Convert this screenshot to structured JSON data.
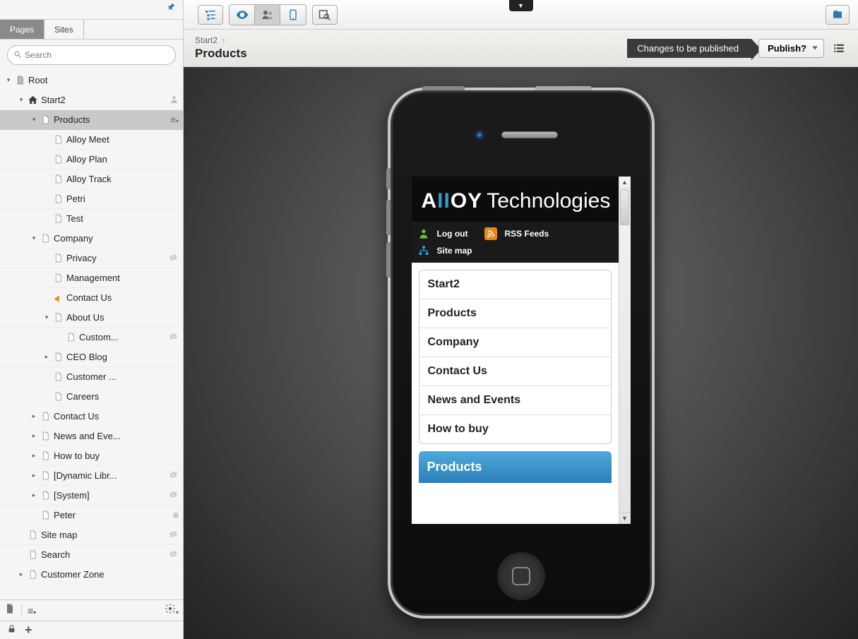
{
  "sidebar": {
    "tabs": {
      "pages": "Pages",
      "sites": "Sites"
    },
    "search_placeholder": "Search",
    "tree": [
      {
        "label": "Root",
        "depth": 0,
        "toggle": "minus",
        "icon": "page-grey"
      },
      {
        "label": "Start2",
        "depth": 1,
        "toggle": "minus",
        "icon": "home",
        "right_icon": "person"
      },
      {
        "label": "Products",
        "depth": 2,
        "toggle": "minus",
        "icon": "page",
        "selected": true,
        "right_icon": "menu"
      },
      {
        "label": "Alloy Meet",
        "depth": 3,
        "icon": "page"
      },
      {
        "label": "Alloy Plan",
        "depth": 3,
        "icon": "page"
      },
      {
        "label": "Alloy Track",
        "depth": 3,
        "icon": "page"
      },
      {
        "label": "Petri",
        "depth": 3,
        "icon": "page"
      },
      {
        "label": "Test",
        "depth": 3,
        "icon": "page"
      },
      {
        "label": "Company",
        "depth": 2,
        "toggle": "minus",
        "icon": "page"
      },
      {
        "label": "Privacy",
        "depth": 3,
        "icon": "page",
        "right_icon": "eye-off"
      },
      {
        "label": "Management",
        "depth": 3,
        "icon": "page"
      },
      {
        "label": "Contact Us",
        "depth": 3,
        "icon": "shortcut"
      },
      {
        "label": "About Us",
        "depth": 3,
        "toggle": "minus",
        "icon": "page"
      },
      {
        "label": "Custom...",
        "depth": 4,
        "icon": "page",
        "right_icon": "eye-off"
      },
      {
        "label": "CEO Blog",
        "depth": 3,
        "toggle": "plus",
        "icon": "page"
      },
      {
        "label": "Customer ...",
        "depth": 3,
        "icon": "page"
      },
      {
        "label": "Careers",
        "depth": 3,
        "icon": "page"
      },
      {
        "label": "Contact Us",
        "depth": 2,
        "toggle": "plus",
        "icon": "page"
      },
      {
        "label": "News and Eve...",
        "depth": 2,
        "toggle": "plus",
        "icon": "page"
      },
      {
        "label": "How to buy",
        "depth": 2,
        "toggle": "plus",
        "icon": "page"
      },
      {
        "label": "[Dynamic Libr...",
        "depth": 2,
        "toggle": "plus",
        "icon": "page",
        "right_icon": "eye-off"
      },
      {
        "label": "[System]",
        "depth": 2,
        "toggle": "plus",
        "icon": "page",
        "right_icon": "eye-off"
      },
      {
        "label": "Peter",
        "depth": 2,
        "icon": "page",
        "right_icon": "dot"
      },
      {
        "label": "Site map",
        "depth": 1,
        "icon": "page",
        "right_icon": "eye-off"
      },
      {
        "label": "Search",
        "depth": 1,
        "icon": "page",
        "right_icon": "eye-off"
      },
      {
        "label": "Customer Zone",
        "depth": 1,
        "toggle": "plus",
        "icon": "page"
      }
    ]
  },
  "header": {
    "breadcrumb_parent": "Start2",
    "title": "Products",
    "status": "Changes to be published",
    "publish_btn": "Publish?"
  },
  "preview": {
    "logo_part1": "A",
    "logo_part2": "II",
    "logo_part3": "OY",
    "logo_suffix": "Technologies",
    "utility": {
      "logout": "Log out",
      "rss": "RSS Feeds",
      "sitemap": "Site map"
    },
    "nav": [
      "Start2",
      "Products",
      "Company",
      "Contact Us",
      "News and Events",
      "How to buy"
    ],
    "section_title": "Products"
  }
}
